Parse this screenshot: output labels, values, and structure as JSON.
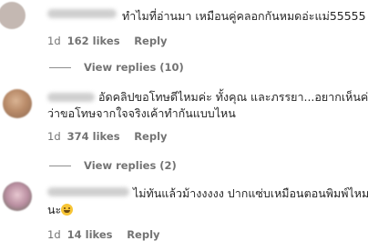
{
  "comments": [
    {
      "text_lines": [
        "ทำไมที่อ่านมา เหมือนคู่คลอกกันหมดอ่ะแม่55555"
      ],
      "date": "1d",
      "likes": "162 likes",
      "reply": "Reply",
      "view_replies": "View replies (10)"
    },
    {
      "text_lines": [
        "อัดคลิปขอโทษดีไหมค่ะ ทั้งคุณ และภรรยา...อยากเห็นค่ะ",
        "ว่าขอโทษจากใจจริงเค้าทำกันแบบไหน"
      ],
      "date": "1d",
      "likes": "374 likes",
      "reply": "Reply",
      "view_replies": "View replies (2)"
    },
    {
      "text_lines": [
        "ไม่ทันแล้วม้างงงงง ปากแซ่บเหมือนตอนพิมพ์ไหม",
        "นะ"
      ],
      "emoji": "grinning-face-icon",
      "date": "1d",
      "likes": "14 likes",
      "reply": "Reply"
    }
  ]
}
